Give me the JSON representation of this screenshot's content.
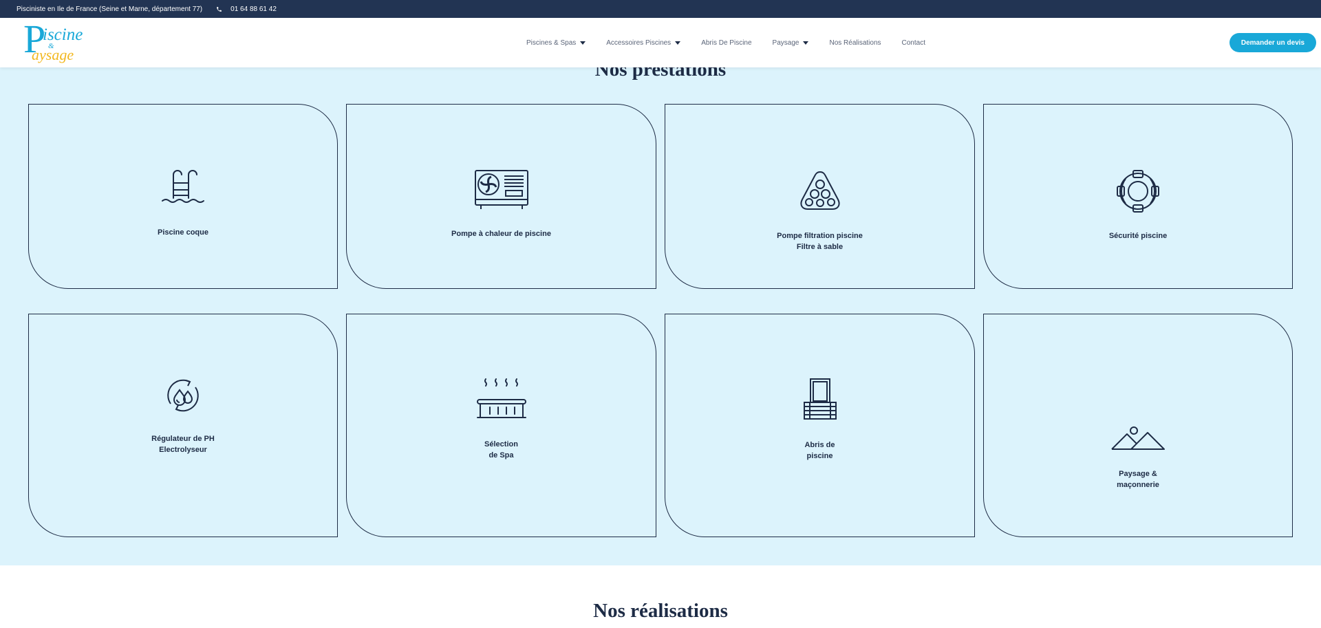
{
  "topbar": {
    "tagline": "Pisciniste en Ile de France (Seine et Marne, département 77)",
    "phone": "01 64 88 61 42"
  },
  "header": {
    "logo": {
      "letter": "P",
      "word1": "iscine",
      "amp": "&",
      "word2": "aysage"
    },
    "nav": [
      {
        "label": "Piscines & Spas",
        "dropdown": true
      },
      {
        "label": "Accessoires Piscines",
        "dropdown": true
      },
      {
        "label": "Abris De Piscine",
        "dropdown": false
      },
      {
        "label": "Paysage",
        "dropdown": true
      },
      {
        "label": "Nos Réalisations",
        "dropdown": false
      },
      {
        "label": "Contact",
        "dropdown": false
      }
    ],
    "cta_label": "Demander un devis"
  },
  "services": {
    "title": "Nos prestations",
    "cards": [
      {
        "label": "Piscine coque",
        "icon": "pool-ladder-icon"
      },
      {
        "label": "Pompe à chaleur de piscine",
        "icon": "heat-pump-icon"
      },
      {
        "label": "Pompe filtration piscine\nFiltre à sable",
        "icon": "sand-filter-icon"
      },
      {
        "label": "Sécurité piscine",
        "icon": "lifebuoy-icon"
      },
      {
        "label": "Régulateur de PH\nElectrolyseur",
        "icon": "ph-regulator-icon"
      },
      {
        "label": "Sélection\nde Spa",
        "icon": "spa-icon"
      },
      {
        "label": "Abris de\npiscine",
        "icon": "pool-shelter-icon"
      },
      {
        "label": "Paysage &\nmaçonnerie",
        "icon": "landscape-icon"
      }
    ]
  },
  "realisations": {
    "title": "Nos réalisations"
  },
  "colors": {
    "topbar_bg": "#223453",
    "accent": "#19a8d8",
    "logo_yellow": "#f2b820",
    "section_bg": "#dcf3fc",
    "ink": "#1d2b45"
  }
}
